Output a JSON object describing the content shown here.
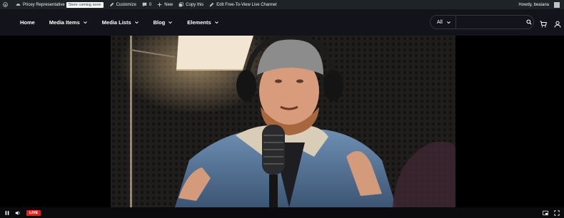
{
  "adminbar": {
    "site_name": "Pricey Representative",
    "store_badge": "Store coming soon",
    "customize": "Customize",
    "comments_count": "0",
    "new_label": "New",
    "copy_label": "Copy this",
    "edit_label": "Edit Free-To-View Live Channel",
    "greeting": "Howdy, beaiana"
  },
  "nav": {
    "home": "Home",
    "media_items": "Media Items",
    "media_lists": "Media Lists",
    "blog": "Blog",
    "elements": "Elements"
  },
  "search": {
    "category": "All",
    "placeholder": ""
  },
  "player": {
    "live_label": "LIVE"
  },
  "colors": {
    "adminbar_bg": "#1d2327",
    "header_bg": "#13131c",
    "live_red": "#e1251b"
  }
}
